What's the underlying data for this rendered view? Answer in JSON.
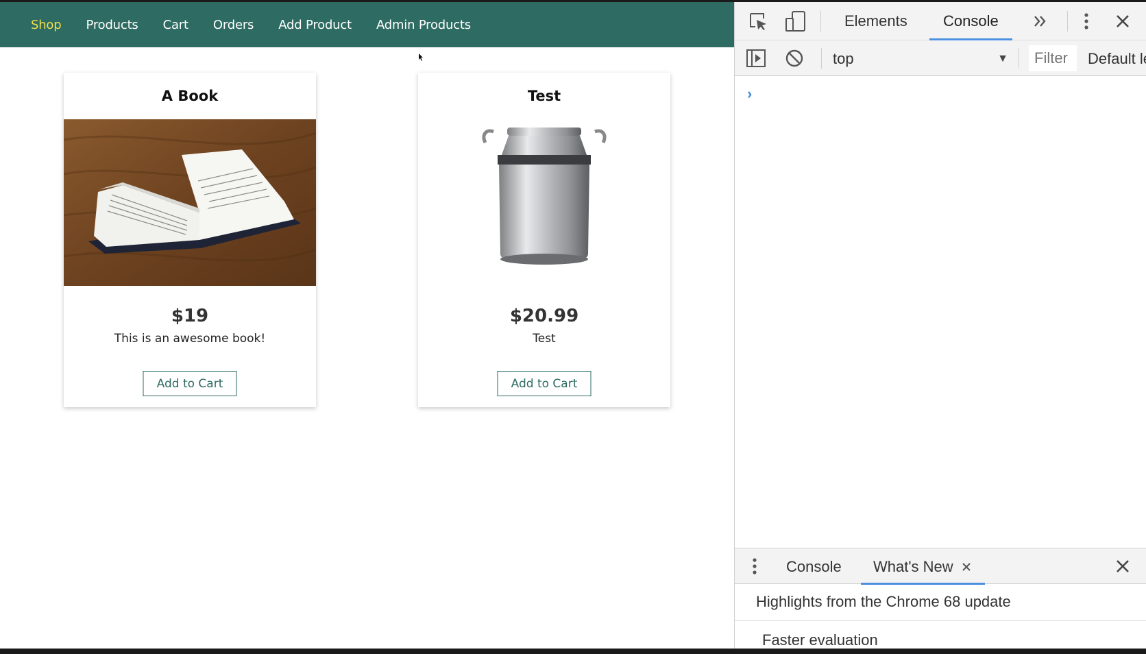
{
  "app": {
    "nav": [
      {
        "label": "Shop",
        "active": true
      },
      {
        "label": "Products"
      },
      {
        "label": "Cart"
      },
      {
        "label": "Orders"
      },
      {
        "label": "Add Product"
      },
      {
        "label": "Admin Products"
      }
    ],
    "products": [
      {
        "title": "A Book",
        "price": "$19",
        "description": "This is an awesome book!",
        "button": "Add to Cart",
        "image": "open-book-photo"
      },
      {
        "title": "Test",
        "price": "$20.99",
        "description": "Test",
        "button": "Add to Cart",
        "image": "milk-can-photo"
      }
    ]
  },
  "devtools": {
    "tabs": {
      "elements": "Elements",
      "console": "Console"
    },
    "context": "top",
    "filter_placeholder": "Filter",
    "levels": "Default levels",
    "drawer": {
      "tabs": {
        "console": "Console",
        "whats_new": "What's New"
      },
      "highlights": "Highlights from the Chrome 68 update",
      "partial_text": "Faster evaluation"
    }
  },
  "colors": {
    "navbar": "#2e6b62",
    "active_nav": "#f0e04b",
    "accent_blue": "#4a8fe0"
  }
}
